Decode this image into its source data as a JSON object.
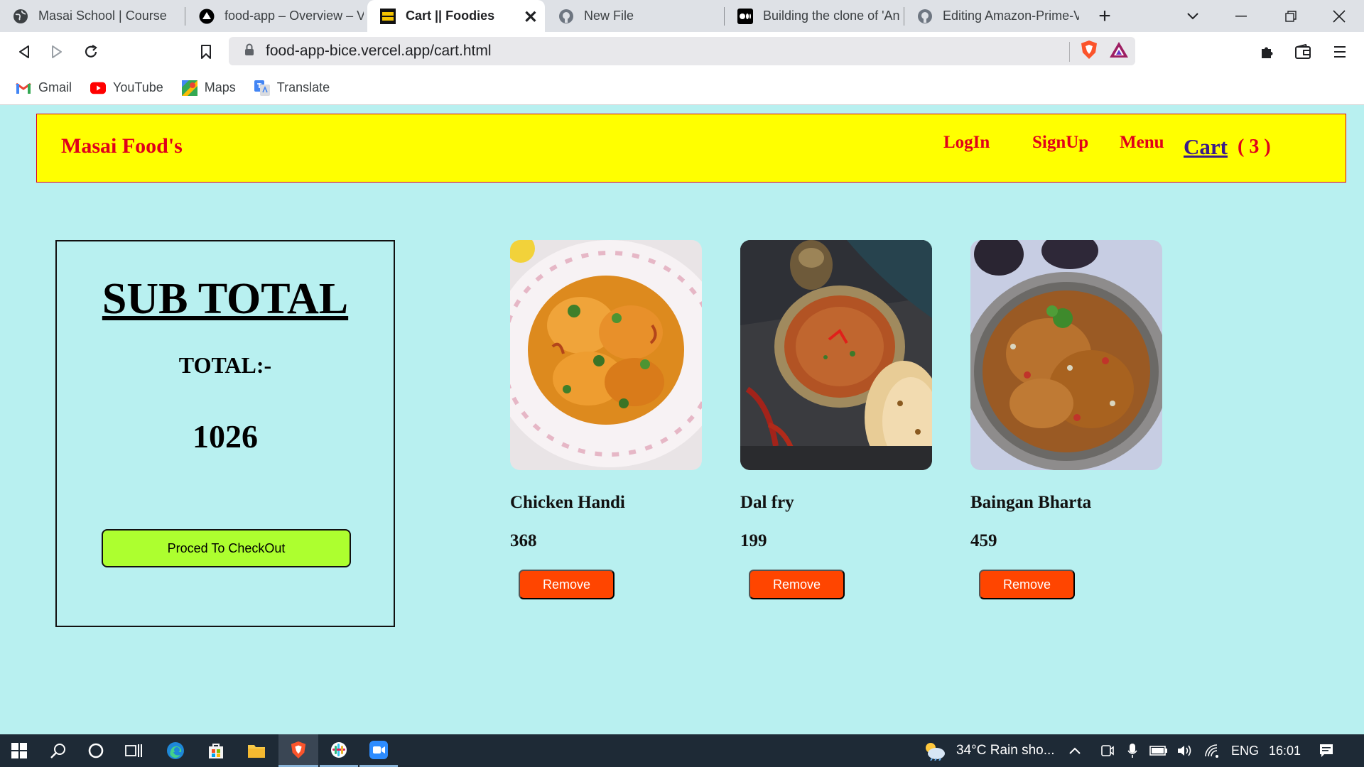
{
  "browser": {
    "tabs": [
      {
        "label": "Masai School | Course",
        "icon": "globe-icon"
      },
      {
        "label": "food-app – Overview – V",
        "icon": "vercel-icon"
      },
      {
        "label": "Cart || Foodies",
        "icon": "food-favicon",
        "active": true
      },
      {
        "label": "New File",
        "icon": "github-icon"
      },
      {
        "label": "Building the clone of 'An",
        "icon": "medium-icon"
      },
      {
        "label": "Editing Amazon-Prime-V",
        "icon": "github-icon"
      }
    ],
    "url": "food-app-bice.vercel.app/cart.html",
    "bookmarks": [
      {
        "label": "Gmail",
        "icon": "gmail-icon"
      },
      {
        "label": "YouTube",
        "icon": "youtube-icon"
      },
      {
        "label": "Maps",
        "icon": "maps-icon"
      },
      {
        "label": "Translate",
        "icon": "translate-icon"
      }
    ]
  },
  "site": {
    "brand": "Masai Food's",
    "nav": {
      "login": "LogIn",
      "signup": "SignUp",
      "menu": "Menu",
      "cart": "Cart",
      "cart_count": "( 3 )"
    },
    "colors": {
      "header_bg": "#ffff00",
      "nav_text": "#e0001a",
      "page_bg": "#b8f0f0",
      "checkout_bg": "#adff2f",
      "remove_bg": "#ff4500"
    }
  },
  "subtotal": {
    "title": "SUB TOTAL",
    "total_label": "TOTAL:-",
    "total_value": "1026",
    "checkout_label": "Proced To CheckOut"
  },
  "cart_items": [
    {
      "name": "Chicken Handi",
      "price": "368",
      "remove_label": "Remove"
    },
    {
      "name": "Dal fry",
      "price": "199",
      "remove_label": "Remove"
    },
    {
      "name": "Baingan Bharta",
      "price": "459",
      "remove_label": "Remove"
    }
  ],
  "taskbar": {
    "weather": "34°C  Rain sho...",
    "language": "ENG",
    "time": "16:01"
  }
}
